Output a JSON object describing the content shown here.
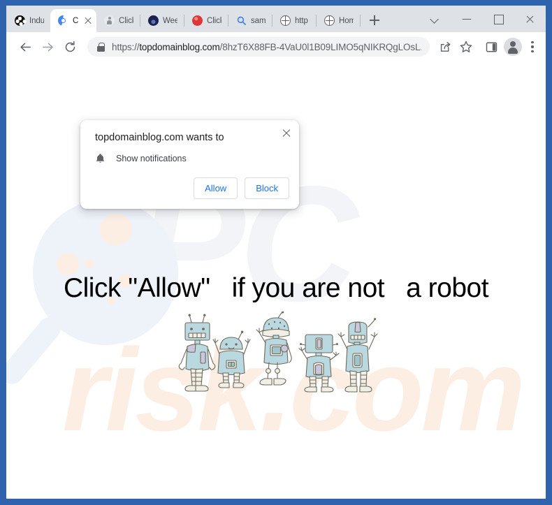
{
  "window": {
    "frame_color": "#2f63ad",
    "controls": [
      {
        "name": "tab-search-chevron",
        "icon": "chevron-down-icon"
      },
      {
        "name": "minimize",
        "icon": "minimize-icon"
      },
      {
        "name": "maximize",
        "icon": "maximize-icon"
      },
      {
        "name": "close",
        "icon": "close-icon"
      }
    ]
  },
  "tabs": [
    {
      "label": "Indu",
      "favicon": "film-reel-icon",
      "active": false
    },
    {
      "label": "C",
      "favicon": "chrome-icon",
      "active": true
    },
    {
      "label": "Click",
      "favicon": "person-icon",
      "active": false
    },
    {
      "label": "Wee",
      "favicon": "navy-globe-icon",
      "active": false
    },
    {
      "label": "Click",
      "favicon": "red-circle-icon",
      "active": false
    },
    {
      "label": "sam",
      "favicon": "search-icon",
      "active": false
    },
    {
      "label": "http",
      "favicon": "globe-icon",
      "active": false
    },
    {
      "label": "Hom",
      "favicon": "globe-icon",
      "active": false
    }
  ],
  "new_tab_label": "+",
  "toolbar": {
    "back_label": "Back",
    "forward_label": "Forward",
    "reload_label": "Reload",
    "url_prefix": "https://",
    "url_domain": "topdomainblog.com",
    "url_path": "/8hzT6X88FB-4VaU0l1B09LIMO5qNIKRQgLOsL...",
    "url_full": "https://topdomainblog.com/8hzT6X88FB-4VaU0l1B09LIMO5qNIKRQgLOsL...",
    "lock_icon": "lock-icon",
    "share_label": "Share",
    "bookmark_label": "Bookmark this tab",
    "side_panel_label": "Side panel",
    "profile_label": "Profile",
    "menu_label": "Customize and control Google Chrome"
  },
  "dialog": {
    "title": "topdomainblog.com wants to",
    "permission": "Show notifications",
    "permission_icon": "bell-icon",
    "allow_label": "Allow",
    "block_label": "Block",
    "close_label": "Close",
    "accent_color": "#1a73e8"
  },
  "page": {
    "heading": "Click \"Allow\"   if you are not   a robot",
    "illustration_alt": "five hand-drawn robots",
    "robot_color": "#b9d8df",
    "watermark": {
      "part1": "PC",
      "part2": "risk.com",
      "part1_color": "#f2f4f7",
      "part2_color": "#fdeee4",
      "logo": "magnifying-glass-icon"
    }
  }
}
